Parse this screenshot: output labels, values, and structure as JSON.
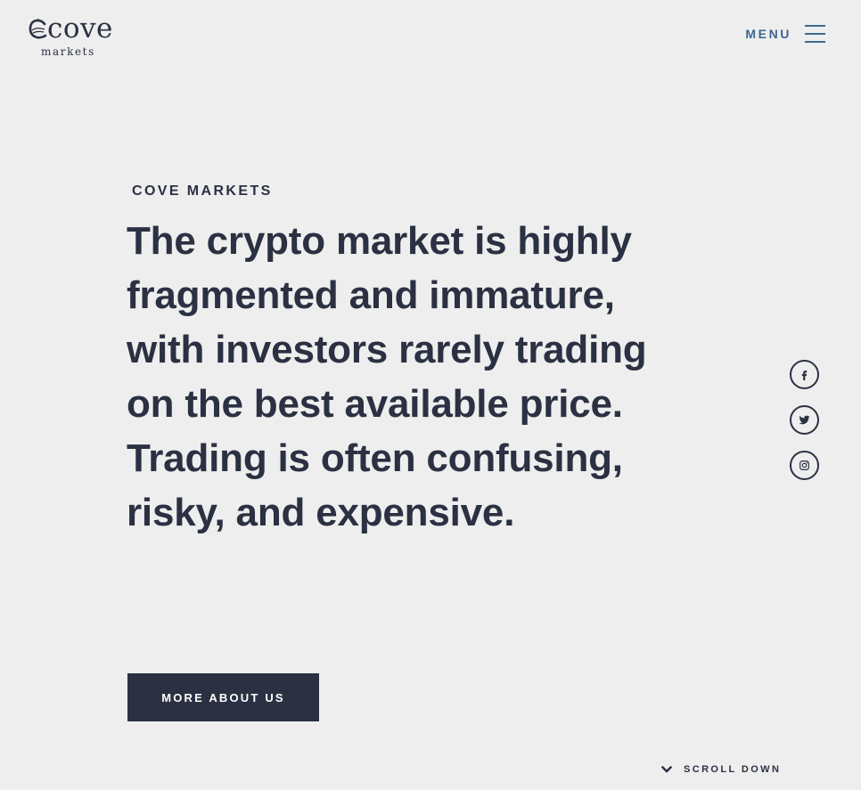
{
  "header": {
    "logo": {
      "word": "cove",
      "sub": "markets"
    },
    "menu_label": "MENU"
  },
  "hero": {
    "eyebrow": "COVE MARKETS",
    "headline": "The crypto market is highly fragmented and immature, with investors rarely trading on the best available price. Trading is often confusing, risky, and expensive.",
    "cta_label": "MORE ABOUT US"
  },
  "social": [
    {
      "icon": "facebook-icon"
    },
    {
      "icon": "twitter-icon"
    },
    {
      "icon": "instagram-icon"
    }
  ],
  "scroll": {
    "label": "SCROLL DOWN",
    "icon": "chevron-down-icon"
  },
  "colors": {
    "background": "#eeeeee",
    "primary_dark": "#2b3142",
    "menu_accent": "#3e6690",
    "button_text": "#ffffff"
  }
}
